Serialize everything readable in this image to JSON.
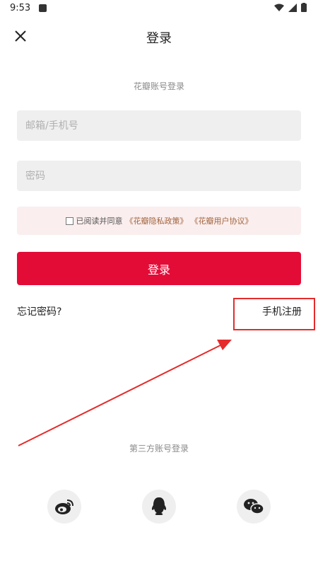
{
  "status_bar": {
    "time": "9:53"
  },
  "header": {
    "title": "登录"
  },
  "form": {
    "subtitle": "花瓣账号登录",
    "email_placeholder": "邮箱/手机号",
    "password_placeholder": "密码",
    "agreement": {
      "prefix": "已阅读并同意",
      "privacy_link": "《花瓣隐私政策》",
      "terms_link": "《花瓣用户协议》"
    },
    "login_label": "登录",
    "forgot_label": "忘记密码?",
    "register_label": "手机注册"
  },
  "third_party": {
    "label": "第三方账号登录",
    "icons": [
      "weibo-icon",
      "qq-icon",
      "wechat-icon"
    ]
  },
  "colors": {
    "accent": "#e30c37",
    "annotation": "#e52b2b",
    "agreement_bg": "#fbeeee",
    "field_bg": "#efefef"
  }
}
